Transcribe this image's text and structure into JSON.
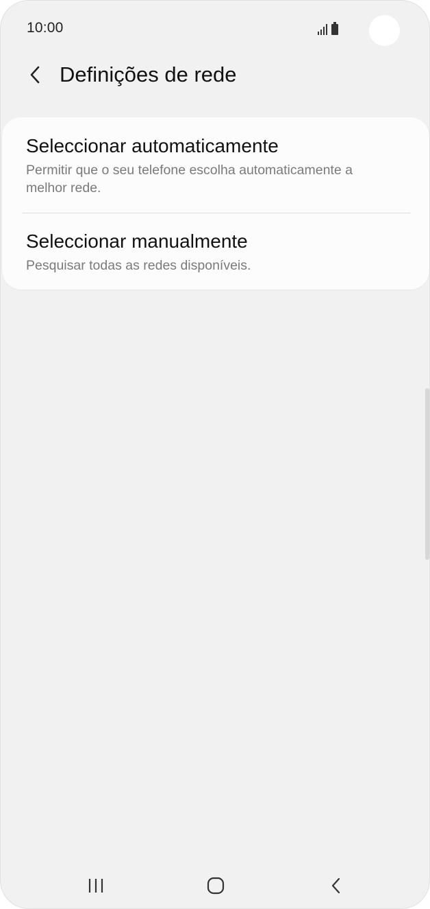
{
  "status_bar": {
    "time": "10:00",
    "icons": [
      "signal-icon",
      "battery-icon"
    ]
  },
  "header": {
    "back_icon": "chevron-left-icon",
    "title": "Definições de rede"
  },
  "options": [
    {
      "title": "Seleccionar automaticamente",
      "description": "Permitir que o seu telefone escolha automaticamente a melhor rede."
    },
    {
      "title": "Seleccionar manualmente",
      "description": "Pesquisar todas as redes disponíveis."
    }
  ],
  "nav_bar": {
    "icons": [
      "recent-apps-icon",
      "home-icon",
      "back-icon"
    ]
  },
  "colors": {
    "background": "#f1f1f1",
    "card": "#fcfcfc",
    "primary_text": "#111111",
    "secondary_text": "#7a7a7a"
  }
}
